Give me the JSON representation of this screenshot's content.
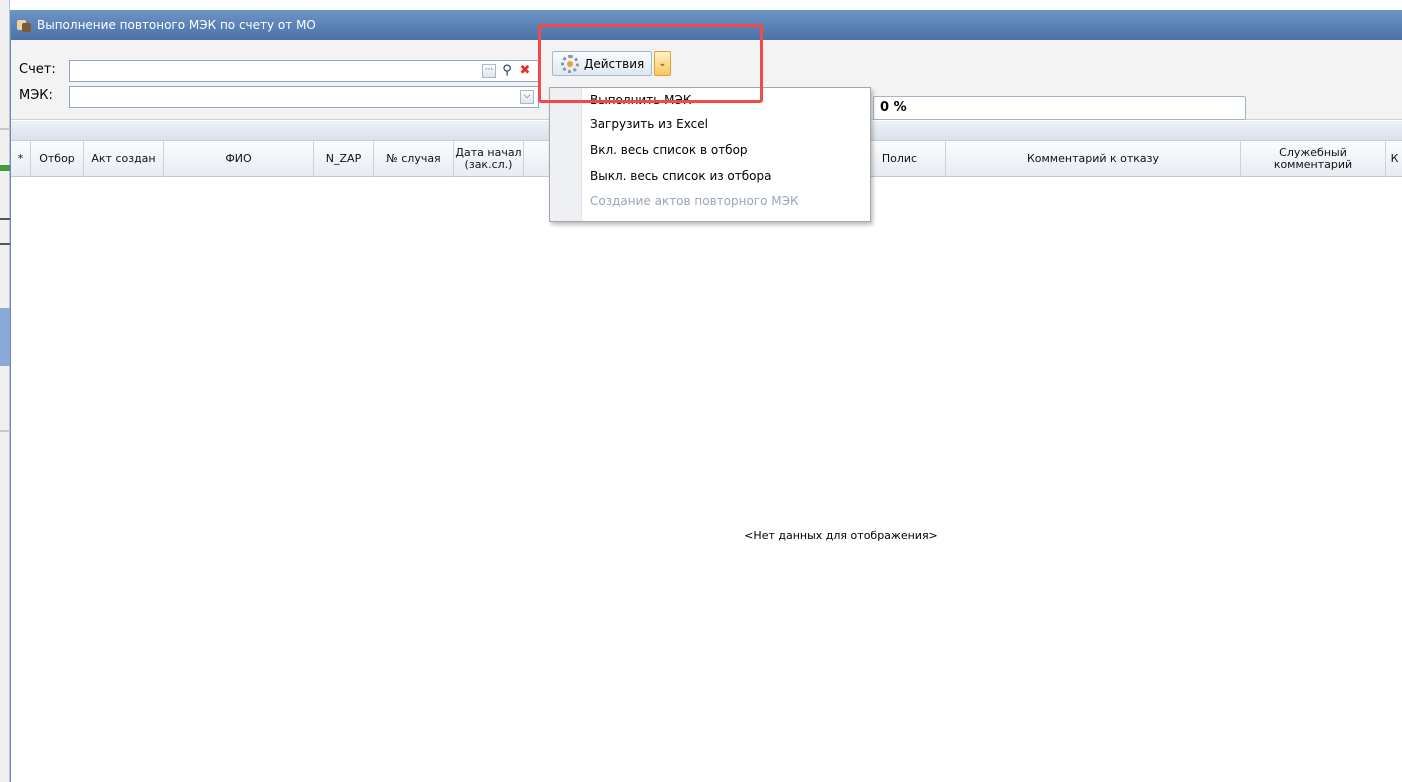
{
  "window": {
    "title": "Выполнение повтоного МЭК по счету от МО"
  },
  "filters": {
    "account_label": "Счет:",
    "account_value": "",
    "mek_label": "МЭК:",
    "mek_value": ""
  },
  "toolbar": {
    "actions_label": "Действия"
  },
  "progress": {
    "text": "0 %",
    "value_percent": 0
  },
  "actions_menu": {
    "items": [
      {
        "label": "Выполнить МЭК",
        "enabled": true
      },
      {
        "label": "Загрузить из Excel",
        "enabled": true
      },
      {
        "label": "Вкл. весь список в отбор",
        "enabled": true
      },
      {
        "label": "Выкл. весь список из отбора",
        "enabled": true
      },
      {
        "label": "Создание актов повторного МЭК",
        "enabled": false
      }
    ]
  },
  "grid": {
    "columns": [
      {
        "label": "*"
      },
      {
        "label": "Отбор"
      },
      {
        "label": "Акт создан"
      },
      {
        "label": "ФИО"
      },
      {
        "label": "N_ZAP"
      },
      {
        "label": "№ случая"
      },
      {
        "label": "Дата начал (зак.сл.)"
      },
      {
        "label": ""
      },
      {
        "label": "Полис"
      },
      {
        "label": "Комментарий к отказу"
      },
      {
        "label": "Служебный комментарий"
      },
      {
        "label": "К"
      }
    ],
    "empty_text": "<Нет данных для отображения>"
  },
  "colors": {
    "title_bar": "#5a80b6",
    "highlight": "#f24a4a",
    "dropdown_accent": "#f6c75b"
  }
}
